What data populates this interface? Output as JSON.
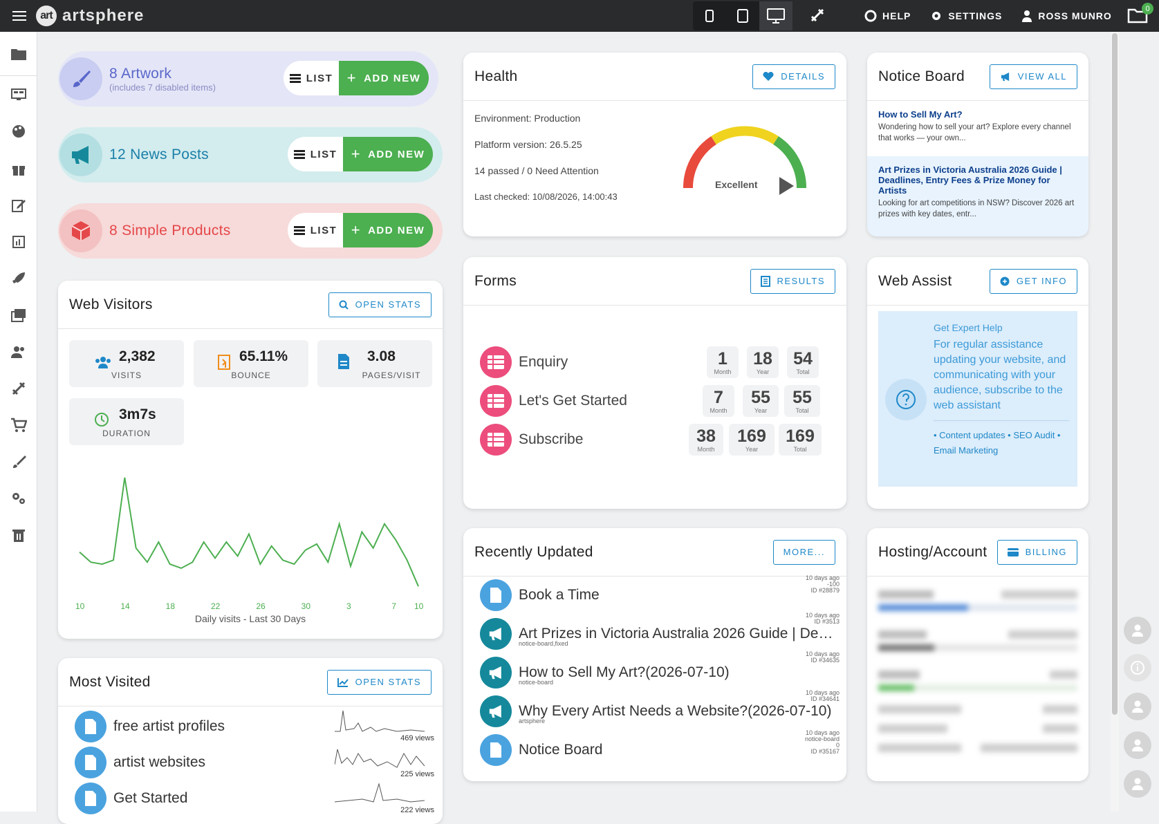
{
  "app": {
    "logo_mark": "art",
    "logo_text": "artsphere"
  },
  "topnav": {
    "help": "HELP",
    "settings": "SETTINGS",
    "user": "ROSS MUNRO",
    "badge": "0"
  },
  "pills": [
    {
      "title": "8 Artwork",
      "sub": "(includes 7 disabled items)",
      "list": "LIST",
      "add": "ADD NEW"
    },
    {
      "title": "12 News Posts",
      "list": "LIST",
      "add": "ADD NEW"
    },
    {
      "title": "8 Simple Products",
      "list": "LIST",
      "add": "ADD NEW"
    }
  ],
  "visitors": {
    "title": "Web Visitors",
    "button": "OPEN STATS",
    "stats": [
      {
        "value": "2,382",
        "label": "VISITS"
      },
      {
        "value": "65.11%",
        "label": "BOUNCE"
      },
      {
        "value": "3.08",
        "label": "PAGES/VISIT"
      },
      {
        "value": "3m7s",
        "label": "DURATION"
      }
    ],
    "caption": "Daily visits - Last 30 Days"
  },
  "chart_data": {
    "type": "line",
    "x": [
      "10",
      "11",
      "12",
      "13",
      "14",
      "15",
      "16",
      "17",
      "18",
      "19",
      "20",
      "21",
      "22",
      "23",
      "24",
      "25",
      "26",
      "27",
      "28",
      "29",
      "30",
      "1",
      "2",
      "3",
      "4",
      "5",
      "6",
      "7",
      "8",
      "9",
      "10"
    ],
    "tick_labels": [
      "10",
      "14",
      "18",
      "22",
      "26",
      "30",
      "3",
      "7",
      "10"
    ],
    "series": [
      {
        "values": [
          38,
          28,
          26,
          30,
          112,
          42,
          28,
          48,
          26,
          22,
          28,
          48,
          32,
          48,
          34,
          56,
          26,
          44,
          30,
          26,
          40,
          46,
          28,
          66,
          24,
          58,
          42,
          66,
          50,
          30,
          4
        ]
      }
    ],
    "color": "#4caf50"
  },
  "mostvisited": {
    "title": "Most Visited",
    "button": "OPEN STATS",
    "items": [
      {
        "name": "free artist profiles",
        "views": "469 views"
      },
      {
        "name": "artist websites",
        "views": "225 views"
      },
      {
        "name": "Get Started",
        "views": "222 views"
      }
    ]
  },
  "health": {
    "title": "Health",
    "button": "DETAILS",
    "environment": "Environment: Production",
    "platform": "Platform version: 26.5.25",
    "checks": "14 passed / 0 Need Attention",
    "last": "Last checked: 10/08/2026, 14:00:43",
    "gauge_label": "Excellent"
  },
  "forms": {
    "title": "Forms",
    "button": "RESULTS",
    "rows": [
      {
        "name": "Enquiry",
        "month": "1",
        "year": "18",
        "total": "54"
      },
      {
        "name": "Let's Get Started",
        "month": "7",
        "year": "55",
        "total": "55"
      },
      {
        "name": "Subscribe",
        "month": "38",
        "year": "169",
        "total": "169"
      }
    ],
    "labels": {
      "month": "Month",
      "year": "Year",
      "total": "Total"
    }
  },
  "recent": {
    "title": "Recently Updated",
    "button": "MORE...",
    "items": [
      {
        "name": "Book a Time",
        "tag": "",
        "meta": [
          "10 days ago",
          "-100",
          "ID #28879"
        ]
      },
      {
        "name": "Art Prizes in Victoria Australia 2026 Guide | Deadlines, Entry Fees & Prize Money for Artists",
        "tag": "notice-board,fixed",
        "meta": [
          "10 days ago",
          "ID #3513"
        ]
      },
      {
        "name": "How to Sell My Art?(2026-07-10)",
        "tag": "notice-board",
        "meta": [
          "10 days ago",
          "ID #34635"
        ]
      },
      {
        "name": "Why Every Artist Needs a Website?(2026-07-10)",
        "tag": "artsphere",
        "meta": [
          "10 days ago",
          "ID #34641"
        ]
      },
      {
        "name": "Notice Board",
        "tag": "",
        "meta": [
          "10 days ago",
          "notice-board",
          "0",
          "ID #35167"
        ]
      }
    ]
  },
  "notice": {
    "title": "Notice Board",
    "button": "VIEW ALL",
    "items": [
      {
        "title": "How to Sell My Art?",
        "text": "Wondering how to sell your art? Explore every channel that works — your own..."
      },
      {
        "title": "Art Prizes in Victoria Australia 2026 Guide | Deadlines, Entry Fees & Prize Money for Artists",
        "text": "Looking for art competitions in NSW? Discover 2026 art prizes with key dates, entr..."
      }
    ]
  },
  "webassist": {
    "title": "Web Assist",
    "button": "GET INFO",
    "heading": "Get Expert Help",
    "body": "For regular assistance updating your website, and communicating with your audience, subscribe to the web assistant",
    "links": "• Content updates • SEO Audit • Email Marketing"
  },
  "hosting": {
    "title": "Hosting/Account",
    "button": "BILLING"
  }
}
